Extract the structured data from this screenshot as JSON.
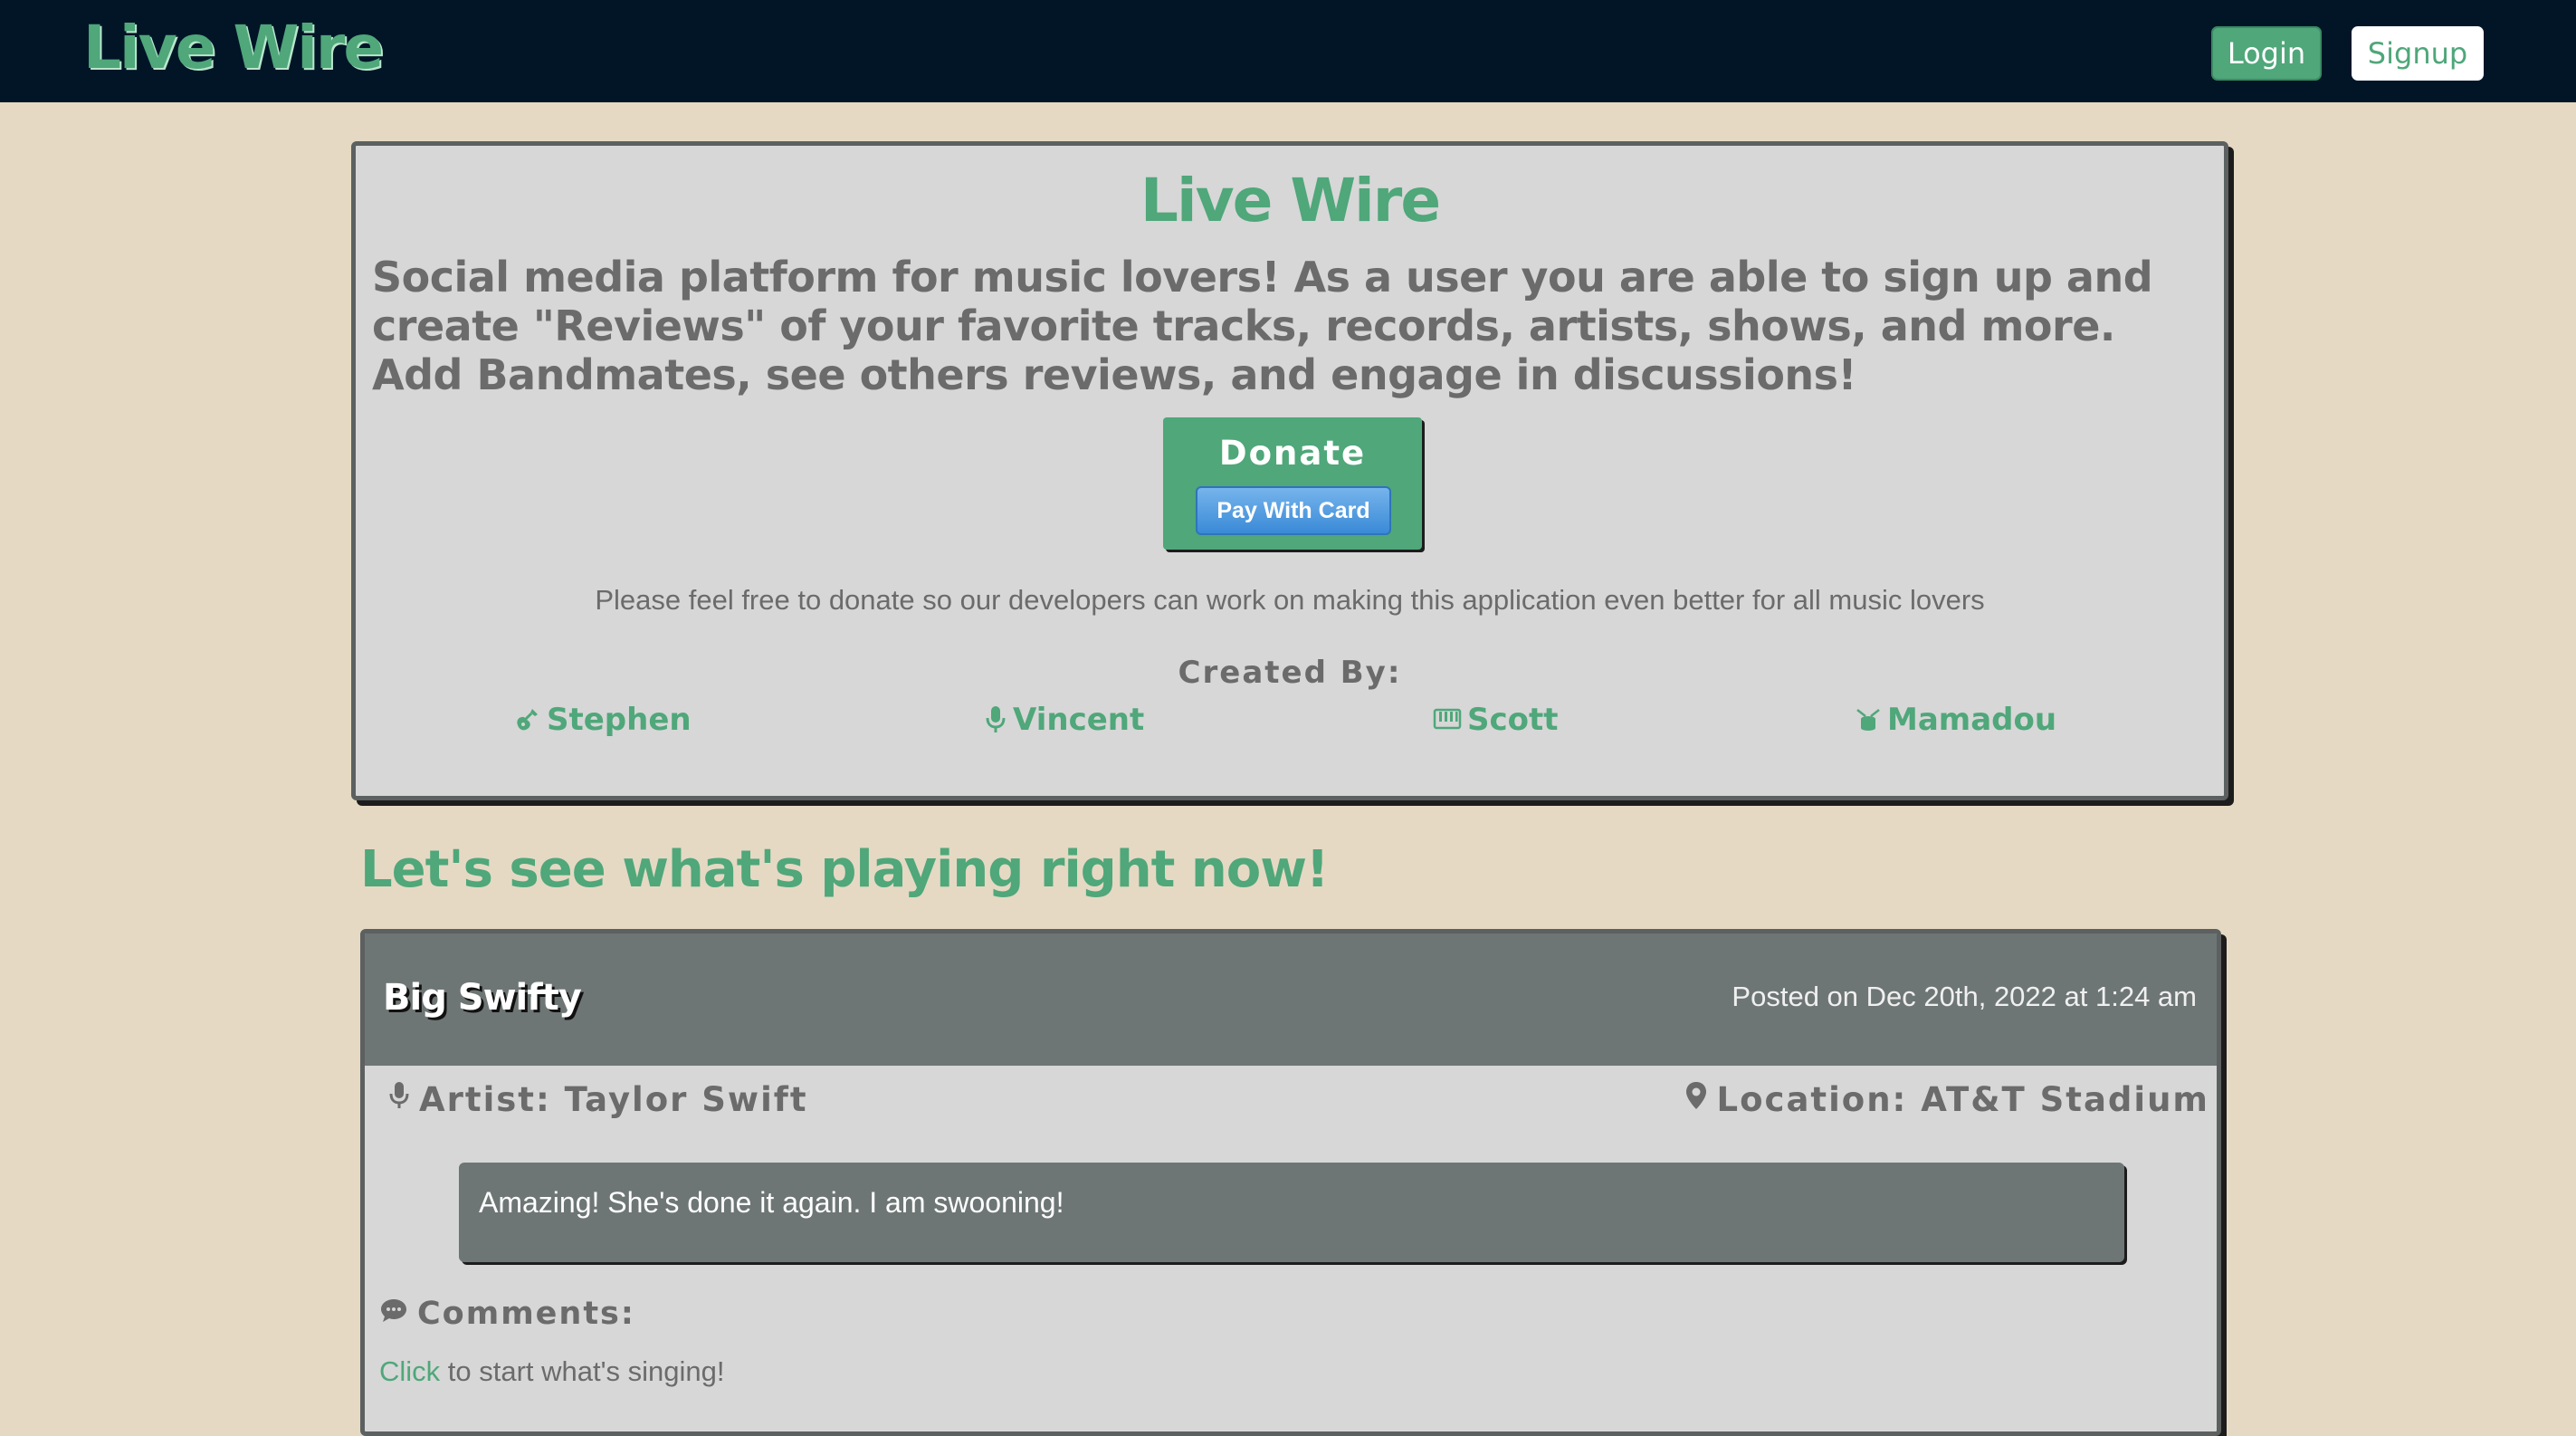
{
  "navbar": {
    "brand": "Live Wire",
    "login_label": "Login",
    "signup_label": "Signup"
  },
  "hero": {
    "title": "Live Wire",
    "description": "Social media platform for music lovers! As a user you are able to sign up and create \"Reviews\" of your favorite tracks, records, artists, shows, and more. Add Bandmates, see others reviews, and engage in discussions!",
    "donate_title": "Donate",
    "pay_button_label": "Pay With Card",
    "donate_note": "Please feel free to donate so our developers can work on making this application even better for all music lovers",
    "created_by_label": "Created By:",
    "creators": [
      {
        "name": "Stephen",
        "icon": "guitar-icon"
      },
      {
        "name": "Vincent",
        "icon": "microphone-icon"
      },
      {
        "name": "Scott",
        "icon": "keyboard-icon"
      },
      {
        "name": "Mamadou",
        "icon": "drum-icon"
      }
    ]
  },
  "feed": {
    "heading": "Let's see what's playing right now!",
    "posts": [
      {
        "title": "Big Swifty",
        "posted": "Posted on Dec 20th, 2022 at 1:24 am",
        "artist": "Artist: Taylor Swift",
        "location": "Location: AT&T Stadium",
        "review": "Amazing! She's done it again. I am swooning!",
        "comments_label": "Comments:",
        "comments_link": "Click",
        "comments_cta_rest": " to start what's singing!"
      }
    ]
  },
  "colors": {
    "background": "#e5d9c3",
    "navbar": "#011527",
    "accent": "#4fa77a",
    "card": "#d7d7d7",
    "card_header": "#6e7675",
    "pay_button": "#3a8ad7",
    "muted_text": "#6b6b6b"
  }
}
